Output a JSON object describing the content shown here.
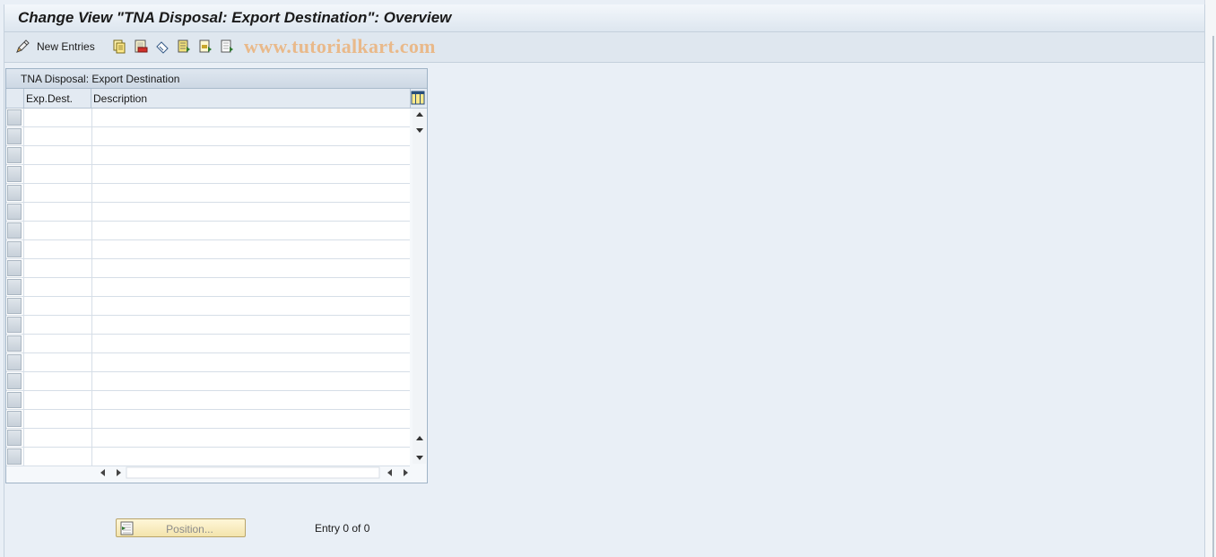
{
  "window": {
    "title": "Change View \"TNA Disposal: Export Destination\": Overview"
  },
  "toolbar": {
    "new_entries_label": "New Entries",
    "watermark": "www.tutorialkart.com",
    "icons": [
      "new-entries-icon",
      "copy-icon",
      "delete-icon",
      "undo-icon",
      "select-all-icon",
      "select-block-icon",
      "deselect-all-icon"
    ]
  },
  "table": {
    "caption": "TNA Disposal: Export Destination",
    "columns": [
      "Exp.Dest.",
      "Description"
    ],
    "rows": []
  },
  "footer": {
    "position_label": "Position...",
    "entry_text": "Entry 0 of 0"
  },
  "colors": {
    "background": "#e9eff6",
    "watermark": "#e9b98a",
    "position_button": "#f3e4ac"
  }
}
